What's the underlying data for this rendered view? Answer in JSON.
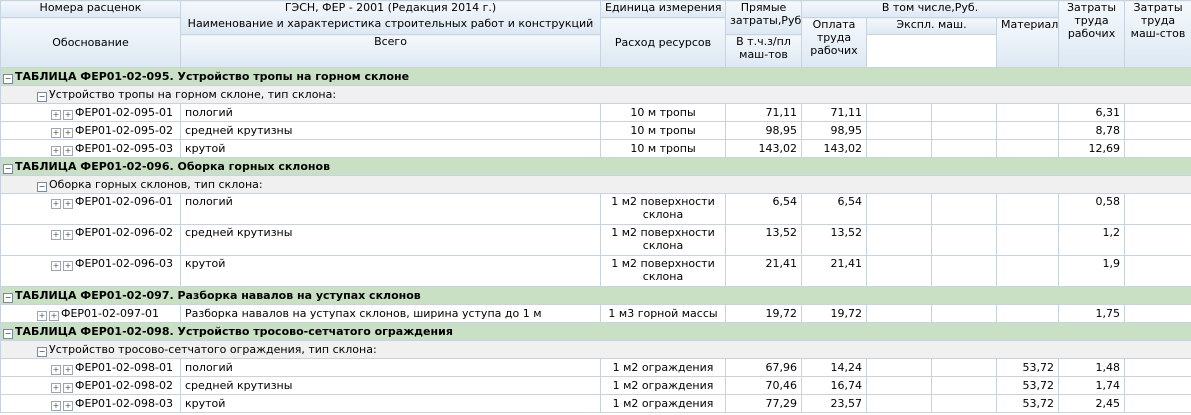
{
  "headers": {
    "code_top": "Номера расценок",
    "code_bottom": "Обоснование",
    "name_top": "ГЭСН, ФЕР - 2001 (Редакция 2014 г.)",
    "name_bottom": "Наименование и характеристика строительных работ и конструкций",
    "unit_top": "Единица измерения",
    "unit_bottom": "Расход ресурсов",
    "direct": "Прямые затраты,Руб.",
    "incl": "В том числе,Руб.",
    "wages": "Оплата труда рабочих",
    "machines": "Экспл. маш.",
    "mach_total": "Всего",
    "mach_wages": "В т.ч.з/пл маш-тов",
    "materials": "Материалы",
    "labor": "Затраты труда рабочих",
    "labor_mach": "Затраты труда маш-стов"
  },
  "sections": [
    {
      "title": "ТАБЛИЦА ФЕР01-02-095. Устройство тропы на горном склоне",
      "group": "Устройство тропы на горном склоне, тип склона:",
      "items": [
        {
          "code": "ФЕР01-02-095-01",
          "name": "пологий",
          "unit": "10 м тропы",
          "direct": "71,11",
          "wages": "71,11",
          "mach_total": "",
          "mach_wages": "",
          "materials": "",
          "labor": "6,31",
          "labor_mach": ""
        },
        {
          "code": "ФЕР01-02-095-02",
          "name": "средней крутизны",
          "unit": "10 м тропы",
          "direct": "98,95",
          "wages": "98,95",
          "mach_total": "",
          "mach_wages": "",
          "materials": "",
          "labor": "8,78",
          "labor_mach": ""
        },
        {
          "code": "ФЕР01-02-095-03",
          "name": "крутой",
          "unit": "10 м тропы",
          "direct": "143,02",
          "wages": "143,02",
          "mach_total": "",
          "mach_wages": "",
          "materials": "",
          "labor": "12,69",
          "labor_mach": ""
        }
      ]
    },
    {
      "title": "ТАБЛИЦА ФЕР01-02-096. Оборка горных склонов",
      "group": "Оборка горных склонов, тип склона:",
      "items": [
        {
          "code": "ФЕР01-02-096-01",
          "name": "пологий",
          "unit": "1 м2 поверхности склона",
          "direct": "6,54",
          "wages": "6,54",
          "mach_total": "",
          "mach_wages": "",
          "materials": "",
          "labor": "0,58",
          "labor_mach": ""
        },
        {
          "code": "ФЕР01-02-096-02",
          "name": "средней крутизны",
          "unit": "1 м2 поверхности склона",
          "direct": "13,52",
          "wages": "13,52",
          "mach_total": "",
          "mach_wages": "",
          "materials": "",
          "labor": "1,2",
          "labor_mach": ""
        },
        {
          "code": "ФЕР01-02-096-03",
          "name": "крутой",
          "unit": "1 м2 поверхности склона",
          "direct": "21,41",
          "wages": "21,41",
          "mach_total": "",
          "mach_wages": "",
          "materials": "",
          "labor": "1,9",
          "labor_mach": ""
        }
      ]
    },
    {
      "title": "ТАБЛИЦА ФЕР01-02-097. Разборка навалов на уступах склонов",
      "items": [
        {
          "code": "ФЕР01-02-097-01",
          "name": "Разборка навалов на уступах склонов, ширина уступа до 1 м",
          "unit": "1 м3 горной массы",
          "direct": "19,72",
          "wages": "19,72",
          "mach_total": "",
          "mach_wages": "",
          "materials": "",
          "labor": "1,75",
          "labor_mach": ""
        }
      ]
    },
    {
      "title": "ТАБЛИЦА ФЕР01-02-098. Устройство тросово-сетчатого ограждения",
      "group": "Устройство тросово-сетчатого ограждения, тип склона:",
      "items": [
        {
          "code": "ФЕР01-02-098-01",
          "name": "пологий",
          "unit": "1 м2 ограждения",
          "direct": "67,96",
          "wages": "14,24",
          "mach_total": "",
          "mach_wages": "",
          "materials": "53,72",
          "labor": "1,48",
          "labor_mach": ""
        },
        {
          "code": "ФЕР01-02-098-02",
          "name": "средней крутизны",
          "unit": "1 м2 ограждения",
          "direct": "70,46",
          "wages": "16,74",
          "mach_total": "",
          "mach_wages": "",
          "materials": "53,72",
          "labor": "1,74",
          "labor_mach": ""
        },
        {
          "code": "ФЕР01-02-098-03",
          "name": "крутой",
          "unit": "1 м2 ограждения",
          "direct": "77,29",
          "wages": "23,57",
          "mach_total": "",
          "mach_wages": "",
          "materials": "53,72",
          "labor": "2,45",
          "labor_mach": ""
        }
      ]
    }
  ],
  "icons": {
    "collapse": "minus-box-icon",
    "expand": "plus-box-icon"
  },
  "colors": {
    "section_bg": "#c9e0c4",
    "group_bg": "#f0f0f0",
    "header_bg": "#dde8f3",
    "grid": "#c8d3e0"
  }
}
